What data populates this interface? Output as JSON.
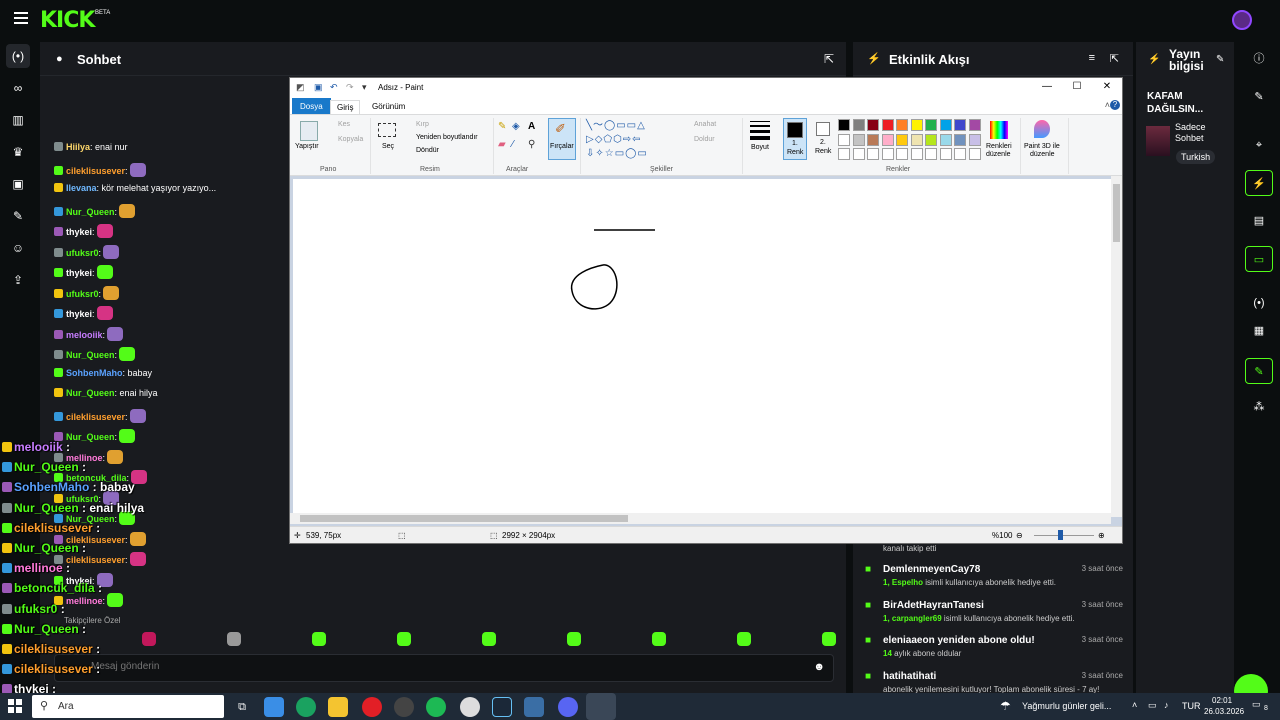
{
  "topbar": {
    "logo": "KICK",
    "beta": "BETA"
  },
  "chat": {
    "title": "Sohbet",
    "messages": [
      {
        "user": "Hiilya",
        "text": ": enai nur",
        "color": "#ffd86b"
      },
      {
        "user": "cileklisusever",
        "text": ":",
        "color": "#ff9f2e"
      },
      {
        "user": "Ilevana",
        "text": ": kör melehat yaşıyor yazıyo...",
        "color": "#6fb8ff"
      },
      {
        "user": "Nur_Queen",
        "text": ":",
        "color": "#53fc18"
      },
      {
        "user": "thykei",
        "text": ":",
        "color": "#ffffff"
      },
      {
        "user": "ufuksr0",
        "text": ":",
        "color": "#53fc18"
      },
      {
        "user": "thykei",
        "text": ":",
        "color": "#ffffff"
      },
      {
        "user": "ufuksr0",
        "text": ":",
        "color": "#53fc18"
      },
      {
        "user": "thykei",
        "text": ":",
        "color": "#ffffff"
      },
      {
        "user": "melooiik",
        "text": ":",
        "color": "#c77dff"
      },
      {
        "user": "Nur_Queen",
        "text": ":",
        "color": "#53fc18"
      },
      {
        "user": "SohbenMaho",
        "text": ": babay",
        "color": "#5aa2ff"
      },
      {
        "user": "Nur_Queen",
        "text": ": enai hilya",
        "color": "#53fc18"
      },
      {
        "user": "cileklisusever",
        "text": ":",
        "color": "#ff9f2e"
      },
      {
        "user": "Nur_Queen",
        "text": ":",
        "color": "#53fc18"
      },
      {
        "user": "mellinoe",
        "text": ":",
        "color": "#ff7ad9"
      },
      {
        "user": "betoncuk_dila",
        "text": ":",
        "color": "#53fc18"
      },
      {
        "user": "ufuksr0",
        "text": ":",
        "color": "#53fc18"
      },
      {
        "user": "Nur_Queen",
        "text": ":",
        "color": "#53fc18"
      },
      {
        "user": "cileklisusever",
        "text": ":",
        "color": "#ff9f2e"
      },
      {
        "user": "cileklisusever",
        "text": ":",
        "color": "#ff9f2e"
      },
      {
        "user": "thykei",
        "text": ":",
        "color": "#ffffff"
      },
      {
        "user": "mellinoe",
        "text": ":",
        "color": "#ff7ad9"
      }
    ],
    "input_placeholder": "Mesaj gönderin",
    "followers_label": "Takipçilere Özel"
  },
  "overlay": [
    {
      "user": "melooiik",
      "text": " :",
      "color": "#c77dff"
    },
    {
      "user": "Nur_Queen",
      "text": " :",
      "color": "#53fc18"
    },
    {
      "user": "SohbenMaho",
      "text": " : babay",
      "color": "#5aa2ff"
    },
    {
      "user": "Nur_Queen",
      "text": " : enai hilya",
      "color": "#53fc18"
    },
    {
      "user": "cileklisusever",
      "text": " :",
      "color": "#ff9f2e"
    },
    {
      "user": "Nur_Queen",
      "text": " :",
      "color": "#53fc18"
    },
    {
      "user": "mellinoe",
      "text": " :",
      "color": "#ff7ad9"
    },
    {
      "user": "betoncuk_dila",
      "text": " :",
      "color": "#53fc18"
    },
    {
      "user": "ufuksr0",
      "text": " :",
      "color": "#53fc18"
    },
    {
      "user": "Nur_Queen",
      "text": " :",
      "color": "#53fc18"
    },
    {
      "user": "cileklisusever",
      "text": " :",
      "color": "#ff9f2e"
    },
    {
      "user": "cileklisusever",
      "text": " :",
      "color": "#ff9f2e"
    },
    {
      "user": "thykei",
      "text": " :",
      "color": "#ffffff"
    }
  ],
  "activity": {
    "title": "Etkinlik Akışı",
    "top_partial": "kanalı takip etti",
    "items": [
      {
        "name": "DemlenmeyenCay78",
        "time": "3 saat önce",
        "sub_bold": "1, Espelho",
        "sub": " isimli kullanıcıya abonelik hediye etti."
      },
      {
        "name": "BirAdetHayranTanesi",
        "time": "3 saat önce",
        "sub_bold": "1, carpangler69",
        "sub": " isimli kullanıcıya abonelik hediye etti."
      },
      {
        "name": "eleniaaeon yeniden abone oldu!",
        "time": "3 saat önce",
        "sub_bold": "14",
        "sub": " aylık abone oldular"
      },
      {
        "name": "hatihatihati",
        "time": "3 saat önce",
        "sub_bold": "",
        "sub": "abonelik yenilemesini kutluyor! Toplam abonelik süresi - 7 ay!"
      }
    ]
  },
  "stream_info": {
    "title_line1": "Yayın",
    "title_line2": "bilgisi",
    "headline_line1": "KAFAM",
    "headline_line2": "DAĞILSIN...",
    "category_line1": "Sadece",
    "category_line2": "Sohbet",
    "tag": "Turkish"
  },
  "paint": {
    "title": "Adsız - Paint",
    "tabs": {
      "file": "Dosya",
      "home": "Giriş",
      "view": "Görünüm"
    },
    "ribbon": {
      "paste": "Yapıştır",
      "cut": "Kes",
      "copy": "Kopyala",
      "group_clipboard": "Pano",
      "select": "Seç",
      "crop": "Kırp",
      "resize": "Yeniden boyutlandır",
      "rotate": "Döndür",
      "group_image": "Resim",
      "group_tools": "Araçlar",
      "brushes": "Fırçalar",
      "outline": "Anahat",
      "fill": "Doldur",
      "group_shapes": "Şekiller",
      "size": "Boyut",
      "color1_a": "1.",
      "color1_b": "Renk",
      "color2_a": "2.",
      "color2_b": "Renk",
      "edit_colors_a": "Renkleri",
      "edit_colors_b": "düzenle",
      "paint3d_a": "Paint 3D ile",
      "paint3d_b": "düzenle",
      "group_colors": "Renkler"
    },
    "palette": [
      "#000000",
      "#7f7f7f",
      "#880015",
      "#ed1c24",
      "#ff7f27",
      "#fff200",
      "#22b14c",
      "#00a2e8",
      "#3f48cc",
      "#a349a4",
      "#ffffff",
      "#c3c3c3",
      "#b97a57",
      "#ffaec9",
      "#ffc90e",
      "#efe4b0",
      "#b5e61d",
      "#99d9ea",
      "#7092be",
      "#c8bfe7"
    ],
    "status": {
      "pos": "539, 75px",
      "size": "2992 × 2904px",
      "zoom": "%100"
    }
  },
  "taskbar": {
    "search": "Ara",
    "weather": "Yağmurlu günler geli...",
    "lang": "TUR",
    "time": "02:01",
    "date": "26.03.2026",
    "notif": "8"
  }
}
